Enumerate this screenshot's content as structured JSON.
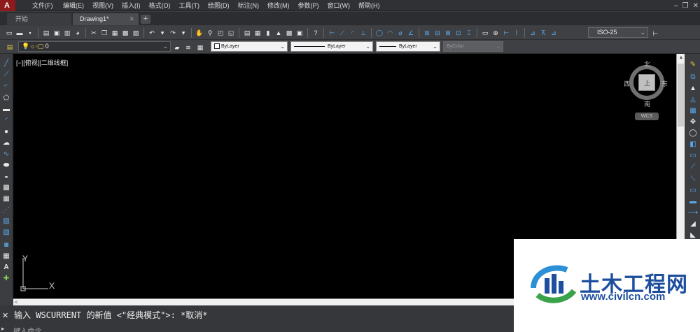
{
  "menubar": {
    "items": [
      "文件(F)",
      "编辑(E)",
      "视图(V)",
      "插入(I)",
      "格式(O)",
      "工具(T)",
      "绘图(D)",
      "标注(N)",
      "修改(M)",
      "参数(P)",
      "窗口(W)",
      "帮助(H)"
    ],
    "window_controls": [
      "–",
      "❐",
      "✕"
    ]
  },
  "tabs": {
    "home": "开始",
    "drawing": "Drawing1*",
    "close": "✕",
    "add": "+"
  },
  "toolbar": {
    "dim_style": "ISO-25",
    "layer": "0",
    "color": "ByLayer",
    "linetype": "ByLayer",
    "lineweight": "ByLayer",
    "plotstyle": "ByColor",
    "dropdown_arrow": "⌄"
  },
  "viewport": {
    "label": "[−][俯视][二维线框]",
    "compass": {
      "north": "北",
      "south": "南",
      "east": "东",
      "west": "西",
      "top": "上"
    },
    "wcs": "WCS",
    "ucs_x": "X",
    "ucs_y": "Y"
  },
  "command": {
    "history": "输入 WSCURRENT 的新值 <\"经典模式\">: *取消*",
    "placeholder": "键入命令",
    "close": "✕",
    "prompt": "▸"
  },
  "scroll": {
    "left": "<",
    "up": "▲",
    "down": "▼"
  },
  "watermark": {
    "title": "土木工程网",
    "url": "www.civilcn.com"
  },
  "colors": {
    "accent": "#1d4f9e",
    "logo_red": "#8d1b1b",
    "canvas": "#000000"
  }
}
